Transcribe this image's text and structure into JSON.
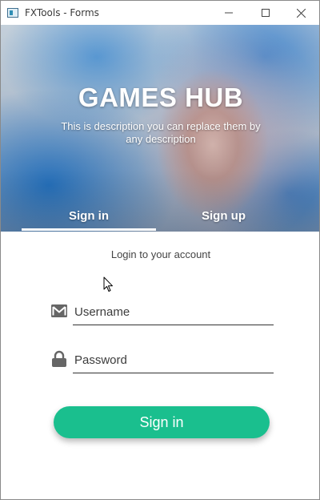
{
  "window": {
    "title": "FXTools - Forms",
    "minimize_icon": "minimize-icon",
    "maximize_icon": "maximize-icon",
    "close_icon": "close-icon"
  },
  "hero": {
    "title": "GAMES HUB",
    "description": "This is description you can replace them by any description"
  },
  "tabs": [
    {
      "label": "Sign in",
      "active": true
    },
    {
      "label": "Sign up",
      "active": false
    }
  ],
  "form": {
    "subtitle": "Login to your account",
    "username": {
      "placeholder": "Username",
      "value": "",
      "icon": "mail-icon"
    },
    "password": {
      "placeholder": "Password",
      "value": "",
      "icon": "lock-icon"
    },
    "submit_label": "Sign in"
  },
  "colors": {
    "accent": "#1abf8e",
    "icon": "#666666",
    "underline": "#333333"
  }
}
